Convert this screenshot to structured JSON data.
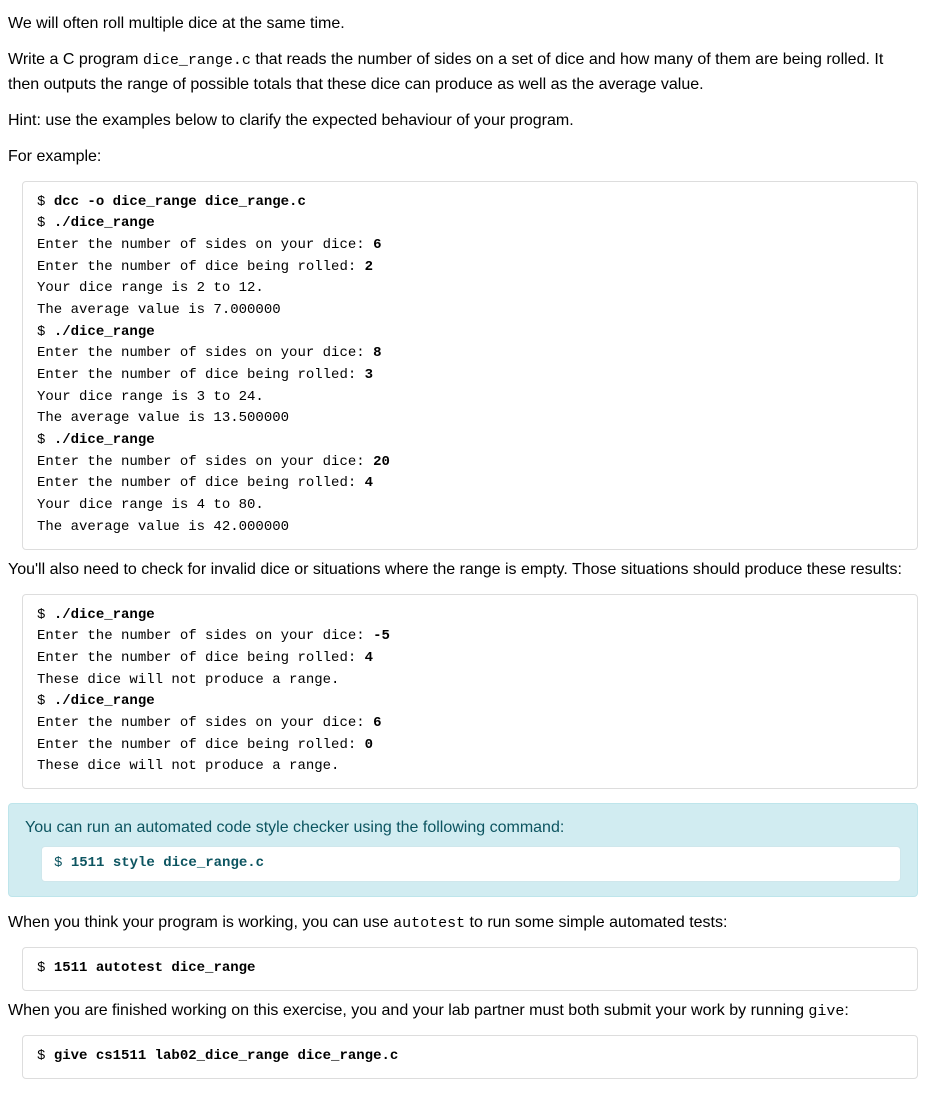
{
  "paragraphs": {
    "intro1": "We will often roll multiple dice at the same time.",
    "intro2_a": "Write a C program ",
    "intro2_code": "dice_range.c",
    "intro2_b": " that reads the number of sides on a set of dice and how many of them are being rolled. It then outputs the range of possible totals that these dice can produce as well as the average value.",
    "hint": "Hint: use the examples below to clarify the expected behaviour of your program.",
    "for_example": "For example:",
    "check_invalid": "You'll also need to check for invalid dice or situations where the range is empty. Those situations should produce these results:",
    "tip_text": "You can run an automated code style checker using the following command:",
    "autotest_a": "When you think your program is working, you can use ",
    "autotest_code": "autotest",
    "autotest_b": " to run some simple automated tests:",
    "give_a": "When you are finished working on this exercise, you and your lab partner must both submit your work by running ",
    "give_code": "give",
    "give_b": ":"
  },
  "terminal1": {
    "l01_p": "$ ",
    "l01_b": "dcc -o dice_range dice_range.c",
    "l02_p": "$ ",
    "l02_b": "./dice_range",
    "l03_a": "Enter the number of sides on your dice: ",
    "l03_b": "6",
    "l04_a": "Enter the number of dice being rolled: ",
    "l04_b": "2",
    "l05": "Your dice range is 2 to 12.",
    "l06": "The average value is 7.000000",
    "l07_p": "$ ",
    "l07_b": "./dice_range",
    "l08_a": "Enter the number of sides on your dice: ",
    "l08_b": "8",
    "l09_a": "Enter the number of dice being rolled: ",
    "l09_b": "3",
    "l10": "Your dice range is 3 to 24.",
    "l11": "The average value is 13.500000",
    "l12_p": "$ ",
    "l12_b": "./dice_range",
    "l13_a": "Enter the number of sides on your dice: ",
    "l13_b": "20",
    "l14_a": "Enter the number of dice being rolled: ",
    "l14_b": "4",
    "l15": "Your dice range is 4 to 80.",
    "l16": "The average value is 42.000000"
  },
  "terminal2": {
    "l01_p": "$ ",
    "l01_b": "./dice_range",
    "l02_a": "Enter the number of sides on your dice: ",
    "l02_b": "-5",
    "l03_a": "Enter the number of dice being rolled: ",
    "l03_b": "4",
    "l04": "These dice will not produce a range.",
    "l05_p": "$ ",
    "l05_b": "./dice_range",
    "l06_a": "Enter the number of sides on your dice: ",
    "l06_b": "6",
    "l07_a": "Enter the number of dice being rolled: ",
    "l07_b": "0",
    "l08": "These dice will not produce a range."
  },
  "terminal_style": {
    "p": "$ ",
    "b": "1511 style dice_range.c"
  },
  "terminal_autotest": {
    "p": "$ ",
    "b": "1511 autotest dice_range"
  },
  "terminal_give": {
    "p": "$ ",
    "b": "give cs1511 lab02_dice_range dice_range.c"
  }
}
